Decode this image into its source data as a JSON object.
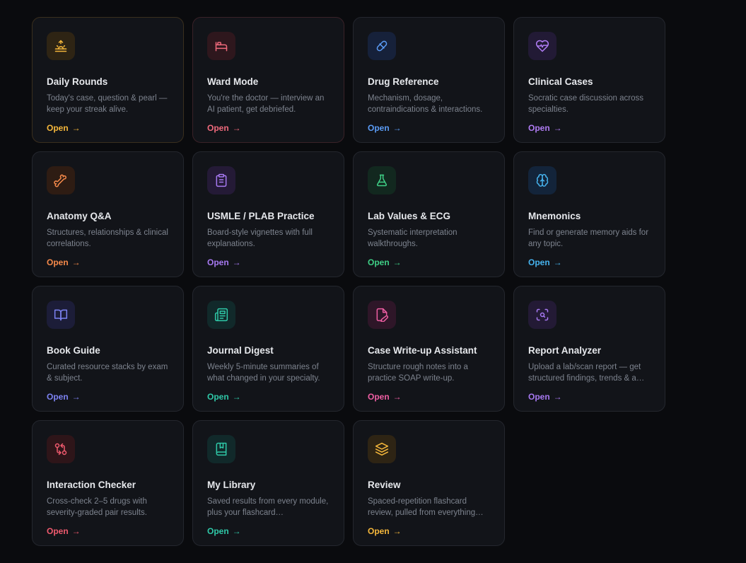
{
  "cards": [
    {
      "title": "Daily Rounds",
      "description": "Today's case, question & pearl — keep your streak alive.",
      "open_label": "Open",
      "arrow": "→",
      "icon": "sunrise-icon",
      "color": "#f5b73b",
      "bg": "#2e2414"
    },
    {
      "title": "Ward Mode",
      "description": "You're the doctor — interview an AI patient, get debriefed.",
      "open_label": "Open",
      "arrow": "→",
      "icon": "bed-icon",
      "color": "#f06a7c",
      "bg": "#2e171d"
    },
    {
      "title": "Drug Reference",
      "description": "Mechanism, dosage, contraindications & interactions.",
      "open_label": "Open",
      "arrow": "→",
      "icon": "pill-icon",
      "color": "#5b9cf6",
      "bg": "#16213a"
    },
    {
      "title": "Clinical Cases",
      "description": "Socratic case discussion across specialties.",
      "open_label": "Open",
      "arrow": "→",
      "icon": "heart-pulse-icon",
      "color": "#b07cf4",
      "bg": "#221a35"
    },
    {
      "title": "Anatomy Q&A",
      "description": "Structures, relationships & clinical correlations.",
      "open_label": "Open",
      "arrow": "→",
      "icon": "bone-icon",
      "color": "#f5894a",
      "bg": "#2e1c13"
    },
    {
      "title": "USMLE / PLAB Practice",
      "description": "Board-style vignettes with full explanations.",
      "open_label": "Open",
      "arrow": "→",
      "icon": "clipboard-icon",
      "color": "#a779f2",
      "bg": "#241a36"
    },
    {
      "title": "Lab Values & ECG",
      "description": "Systematic interpretation walkthroughs.",
      "open_label": "Open",
      "arrow": "→",
      "icon": "flask-icon",
      "color": "#3fcf86",
      "bg": "#12281f"
    },
    {
      "title": "Mnemonics",
      "description": "Find or generate memory aids for any topic.",
      "open_label": "Open",
      "arrow": "→",
      "icon": "brain-icon",
      "color": "#46b3ee",
      "bg": "#13243a"
    },
    {
      "title": "Book Guide",
      "description": "Curated resource stacks by exam & subject.",
      "open_label": "Open",
      "arrow": "→",
      "icon": "book-open-icon",
      "color": "#7d83f3",
      "bg": "#1c1d38"
    },
    {
      "title": "Journal Digest",
      "description": "Weekly 5-minute summaries of what changed in your specialty.",
      "open_label": "Open",
      "arrow": "→",
      "icon": "newspaper-icon",
      "color": "#2fc9a8",
      "bg": "#11292a"
    },
    {
      "title": "Case Write-up Assistant",
      "description": "Structure rough notes into a practice SOAP write-up.",
      "open_label": "Open",
      "arrow": "→",
      "icon": "file-pen-icon",
      "color": "#ef5ea3",
      "bg": "#2e1628"
    },
    {
      "title": "Report Analyzer",
      "description": "Upload a lab/scan report — get structured findings, trends & a…",
      "open_label": "Open",
      "arrow": "→",
      "icon": "scan-search-icon",
      "color": "#a779f2",
      "bg": "#231a35"
    },
    {
      "title": "Interaction Checker",
      "description": "Cross-check 2–5 drugs with severity-graded pair results.",
      "open_label": "Open",
      "arrow": "→",
      "icon": "git-compare-icon",
      "color": "#f05a6e",
      "bg": "#2e1519"
    },
    {
      "title": "My Library",
      "description": "Saved results from every module, plus your flashcard…",
      "open_label": "Open",
      "arrow": "→",
      "icon": "book-marked-icon",
      "color": "#2fc9a8",
      "bg": "#11292a"
    },
    {
      "title": "Review",
      "description": "Spaced-repetition flashcard review, pulled from everything…",
      "open_label": "Open",
      "arrow": "→",
      "icon": "layers-icon",
      "color": "#f5b73b",
      "bg": "#2e2414"
    }
  ]
}
